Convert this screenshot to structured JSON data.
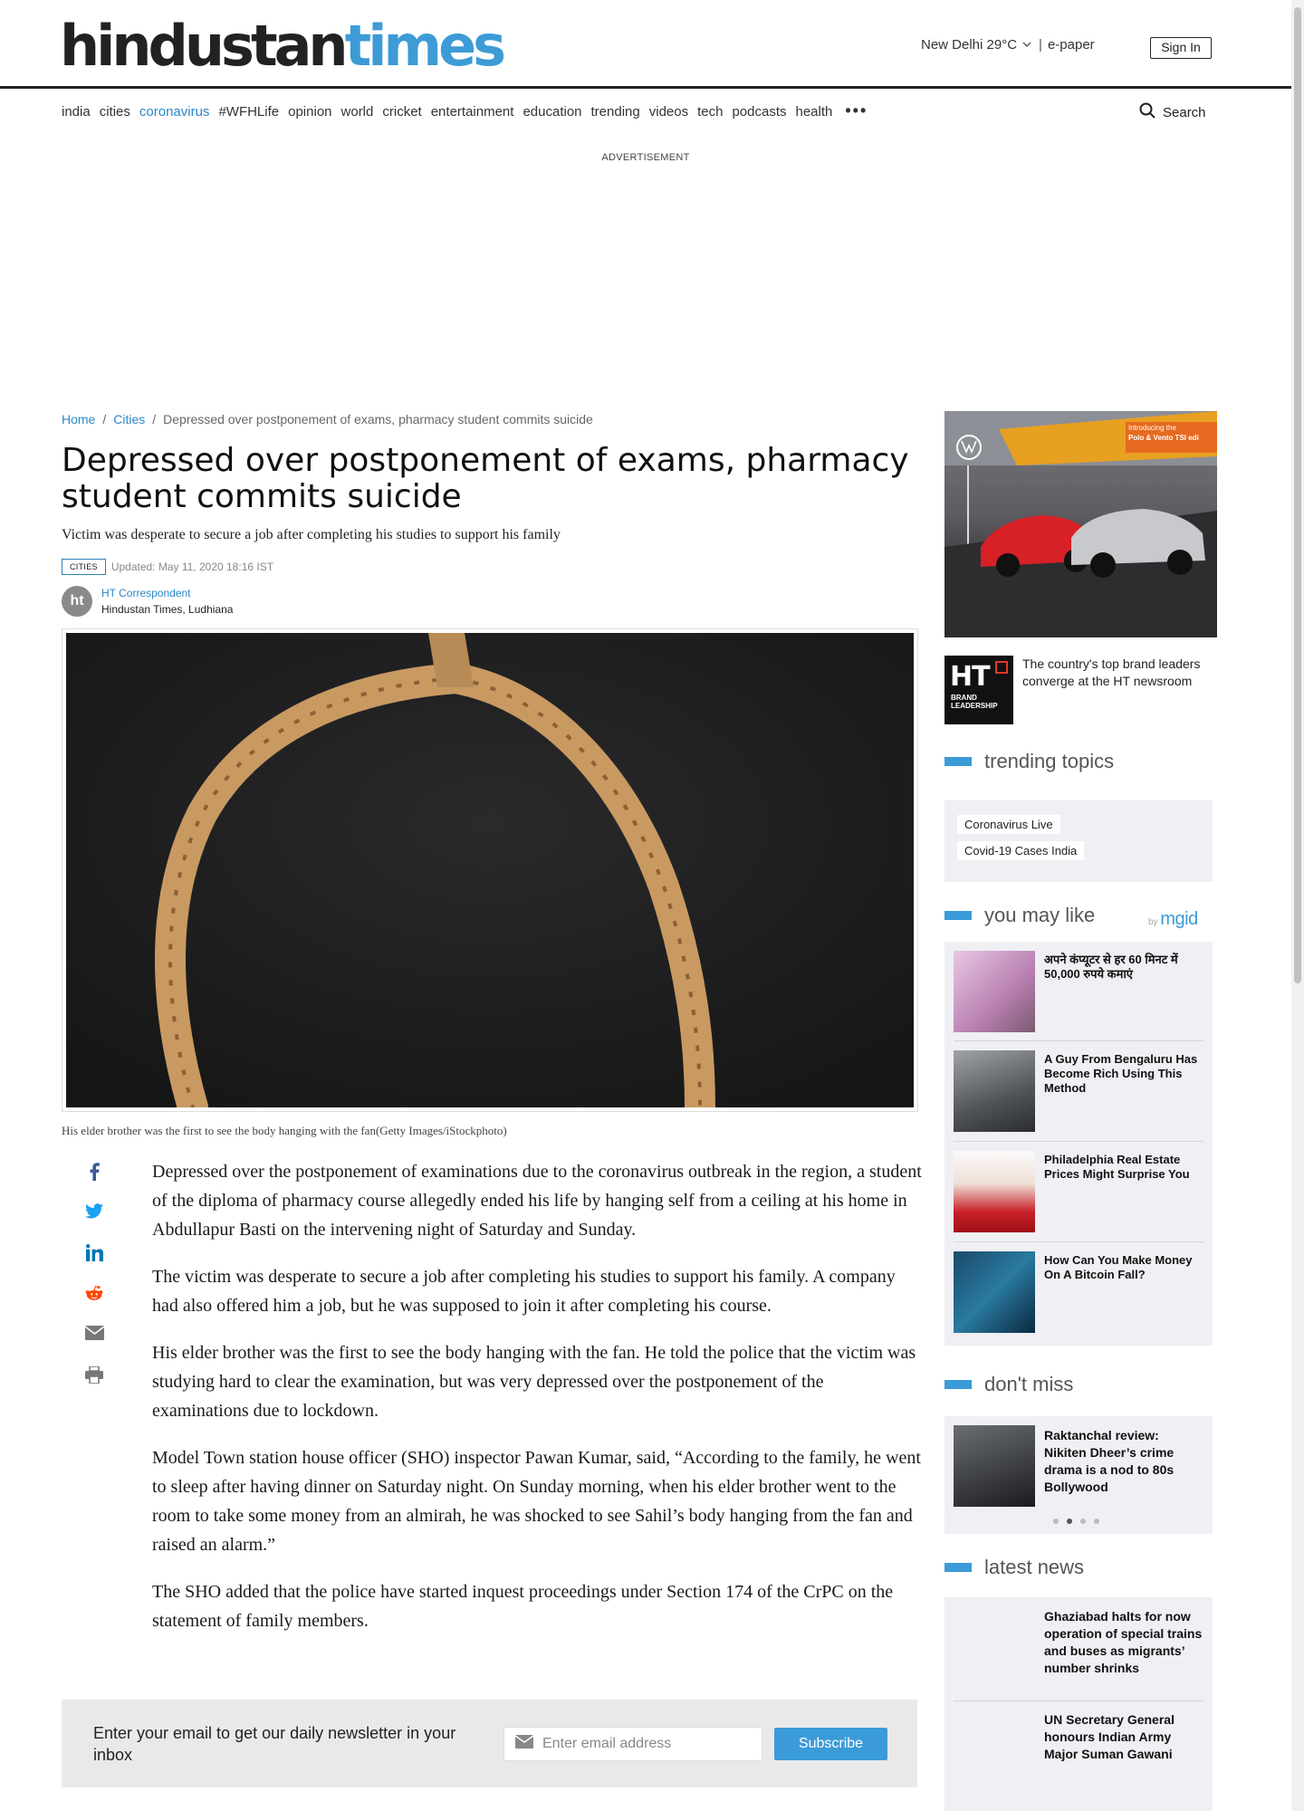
{
  "header": {
    "logo_part1": "hindustan",
    "logo_part2": "times",
    "weather": "New Delhi 29°C",
    "epaper": "e-paper",
    "signin": "Sign In"
  },
  "nav": {
    "items": [
      "india",
      "cities",
      "coronavirus",
      "#WFHLife",
      "opinion",
      "world",
      "cricket",
      "entertainment",
      "education",
      "trending",
      "videos",
      "tech",
      "podcasts",
      "health"
    ],
    "active_item": "coronavirus",
    "more": "•••",
    "search_label": "Search"
  },
  "advertisement_label": "ADVERTISEMENT",
  "breadcrumb": {
    "home": "Home",
    "cities": "Cities",
    "current": "Depressed over postponement of exams, pharmacy student commits suicide"
  },
  "article": {
    "title": "Depressed over postponement of exams, pharmacy student commits suicide",
    "subtitle": "Victim was desperate to secure a job after completing his studies to support his family",
    "tag": "CITIES",
    "updated": "Updated: May 11, 2020 18:16 IST",
    "author_initials": "ht",
    "author_name": "HT Correspondent",
    "author_org": "Hindustan Times, Ludhiana",
    "caption": "His elder brother was the first to see the body hanging with the fan(Getty Images/iStockphoto)",
    "paragraphs": [
      "Depressed over the postponement of examinations due to the coronavirus outbreak in the region, a student of the diploma of pharmacy course allegedly ended his life by hanging self from a ceiling at his home in Abdullapur Basti on the intervening night of Saturday and Sunday.",
      "The victim was desperate to secure a job after completing his studies to support his family. A company had also offered him a job, but he was supposed to join it after completing his course.",
      "His elder brother was the first to see the body hanging with the fan. He told the police that the victim was studying hard to clear the examination, but was very depressed over the postponement of the examinations due to lockdown.",
      "Model Town station house officer (SHO) inspector Pawan Kumar, said, “According to the family, he went to sleep after having dinner on Saturday night. On Sunday morning, when his elder brother went to the room to take some money from an almirah, he was shocked to see Sahil’s body hanging from the fan and raised an alarm.”",
      "The SHO added that the police have started inquest proceedings under Section 174 of the CrPC on the statement of family members."
    ]
  },
  "share_icons": [
    "facebook-icon",
    "twitter-icon",
    "linkedin-icon",
    "reddit-icon",
    "email-icon",
    "print-icon"
  ],
  "newsletter": {
    "text": "Enter your email to get our daily newsletter in your inbox",
    "placeholder": "Enter email address",
    "button": "Subscribe"
  },
  "sidebar": {
    "ad_promo_line1": "Introducing the",
    "ad_promo_line2": "Polo & Vento TSI edi",
    "brand_logo_text": "HT",
    "brand_logo_sub1": "BRAND",
    "brand_logo_sub2": "LEADERSHIP",
    "brand_text": "The country's top brand leaders converge at the HT newsroom",
    "trending_title": "trending topics",
    "trending": [
      "Coronavirus Live",
      "Covid-19 Cases India"
    ],
    "you_may_like_title": "you may like",
    "mgid_by": "by",
    "mgid_name": "mgid",
    "you_may_like": [
      "अपने कंप्यूटर से हर 60 मिनट में 50,000 रुपये कमाएं",
      "A Guy From Bengaluru Has Become Rich Using This Method",
      "Philadelphia Real Estate Prices Might Surprise You",
      "How Can You Make Money On A Bitcoin Fall?"
    ],
    "dont_miss_title": "don't miss",
    "dont_miss": "Raktanchal review: Nikiten Dheer’s crime drama is a nod to 80s Bollywood",
    "latest_title": "latest news",
    "latest": [
      "Ghaziabad halts for now operation of special trains and buses as migrants’ number shrinks",
      "UN Secretary General honours Indian Army Major Suman Gawani"
    ]
  }
}
